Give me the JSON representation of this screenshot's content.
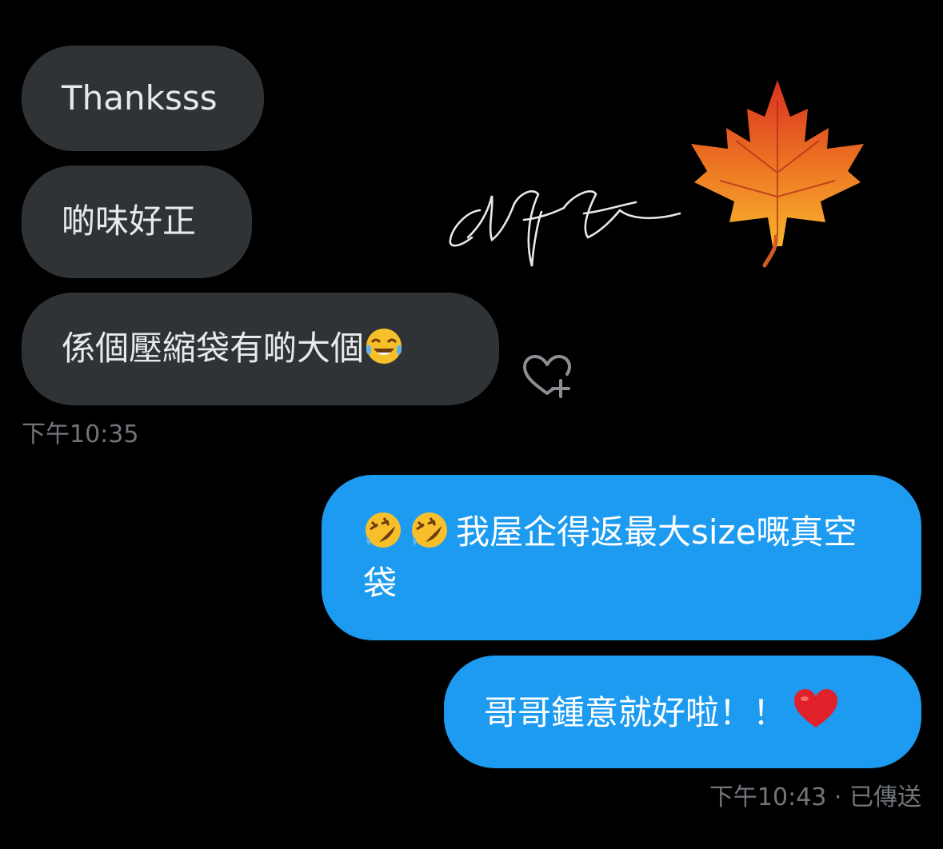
{
  "messages": [
    {
      "side": "received",
      "text": "Thanksss"
    },
    {
      "side": "received",
      "text": "啲味好正"
    },
    {
      "side": "received",
      "text": "係個壓縮袋有啲大個",
      "emoji": "tears-of-joy"
    },
    {
      "side": "sent",
      "emoji": [
        "rolling-laughing",
        "rolling-laughing"
      ],
      "text": "我屋企得返最大size嘅真空袋"
    },
    {
      "side": "sent",
      "text": "哥哥鍾意就好啦！！",
      "emoji": "red-heart"
    }
  ],
  "timestamps": {
    "received": "下午10:35",
    "sent": "下午10:43 · 已傳送"
  },
  "decoration": {
    "signature_text": "ctft",
    "leaf_icon": "maple-leaf-icon"
  },
  "colors": {
    "background": "#000000",
    "received_bubble": "#2f3336",
    "sent_bubble": "#1d9bf0",
    "timestamp": "#71767b"
  }
}
